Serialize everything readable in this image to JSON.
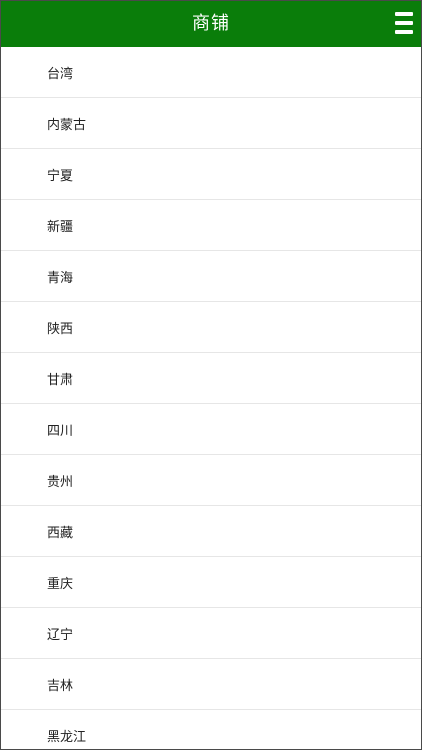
{
  "header": {
    "title": "商铺",
    "menu_icon": "hamburger-menu-icon",
    "background_color": "#0a7d0a",
    "text_color": "#ffffff"
  },
  "regions": [
    {
      "label": "台湾"
    },
    {
      "label": "内蒙古"
    },
    {
      "label": "宁夏"
    },
    {
      "label": "新疆"
    },
    {
      "label": "青海"
    },
    {
      "label": "陕西"
    },
    {
      "label": "甘肃"
    },
    {
      "label": "四川"
    },
    {
      "label": "贵州"
    },
    {
      "label": "西藏"
    },
    {
      "label": "重庆"
    },
    {
      "label": "辽宁"
    },
    {
      "label": "吉林"
    },
    {
      "label": "黑龙江"
    }
  ]
}
